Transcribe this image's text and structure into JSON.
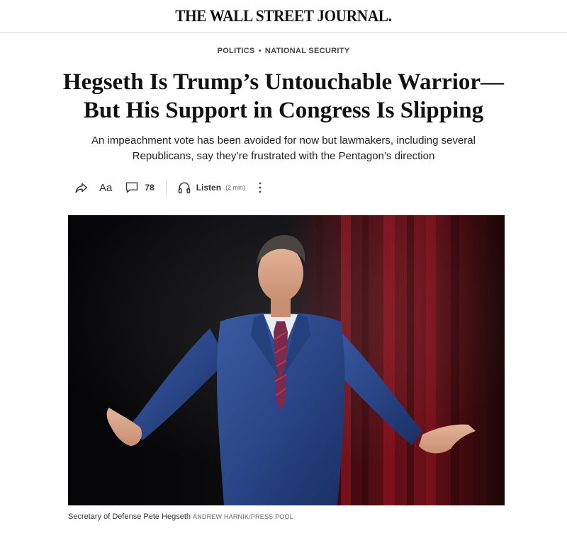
{
  "masthead": {
    "logo_text": "THE WALL STREET JOURNAL."
  },
  "article": {
    "flag": {
      "section": "POLITICS",
      "separator": "•",
      "subsection": "NATIONAL SECURITY"
    },
    "headline_line1": "Hegseth Is Trump’s Untouchable Warrior—",
    "headline_line2": "But His Support in Congress Is Slipping",
    "dek_line1": "An impeachment vote has been avoided for now but lawmakers, including several",
    "dek_line2": "Republicans, say they’re frustrated with the Pentagon’s direction"
  },
  "toolbar": {
    "share_icon": "share-icon",
    "text_size_label": "Aa",
    "comment_icon": "comment-icon",
    "comment_count": "78",
    "listen_icon": "headphones-icon",
    "listen_label": "Listen",
    "listen_duration": "(2 min)",
    "more_icon": "more-vertical-icon"
  },
  "image": {
    "caption": "Secretary of Defense Pete Hegseth",
    "credit": "ANDREW HARNIK/PRESS POOL"
  },
  "colors": {
    "text": "#111111",
    "muted": "#666666",
    "divider": "#dcdcdc",
    "curtain_red": "#7a1018",
    "suit_blue": "#2b4a8c"
  }
}
